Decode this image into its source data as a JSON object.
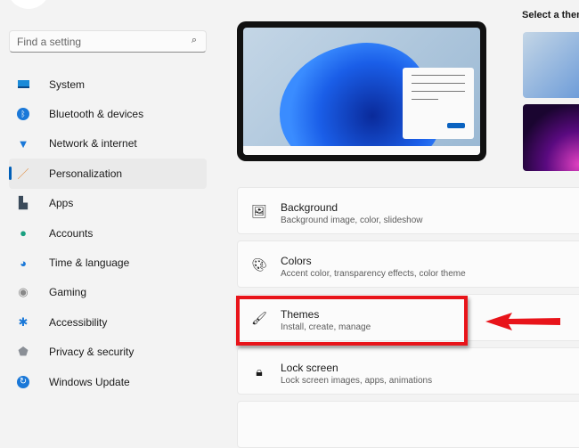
{
  "search": {
    "placeholder": "Find a setting"
  },
  "nav": [
    {
      "label": "System",
      "icon": "monitor-icon"
    },
    {
      "label": "Bluetooth & devices",
      "icon": "bluetooth-icon"
    },
    {
      "label": "Network & internet",
      "icon": "wifi-icon"
    },
    {
      "label": "Personalization",
      "icon": "paintbrush-icon",
      "selected": true
    },
    {
      "label": "Apps",
      "icon": "apps-icon"
    },
    {
      "label": "Accounts",
      "icon": "person-icon"
    },
    {
      "label": "Time & language",
      "icon": "globe-clock-icon"
    },
    {
      "label": "Gaming",
      "icon": "gamepad-icon"
    },
    {
      "label": "Accessibility",
      "icon": "accessibility-icon"
    },
    {
      "label": "Privacy & security",
      "icon": "shield-icon"
    },
    {
      "label": "Windows Update",
      "icon": "update-icon"
    }
  ],
  "themes": {
    "title": "Select a theme"
  },
  "cards": [
    {
      "title": "Background",
      "subtitle": "Background image, color, slideshow",
      "icon": "image-icon"
    },
    {
      "title": "Colors",
      "subtitle": "Accent color, transparency effects, color theme",
      "icon": "palette-icon"
    },
    {
      "title": "Themes",
      "subtitle": "Install, create, manage",
      "icon": "brush-icon"
    },
    {
      "title": "Lock screen",
      "subtitle": "Lock screen images, apps, animations",
      "icon": "lock-screen-icon"
    }
  ],
  "colors": {
    "accent": "#005fb8",
    "annotation": "#e8141a"
  }
}
